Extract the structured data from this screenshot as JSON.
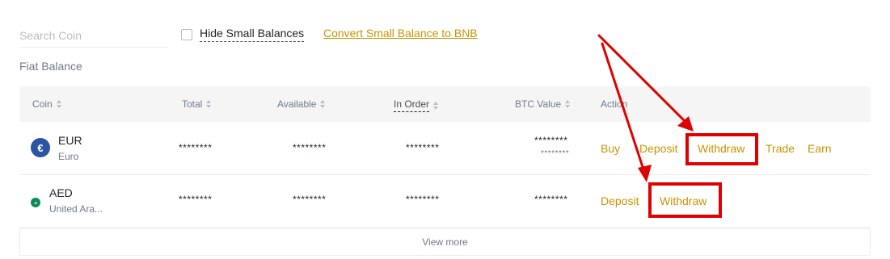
{
  "search": {
    "placeholder": "Search Coin"
  },
  "filters": {
    "hide_small_label": "Hide Small Balances",
    "convert_link": "Convert Small Balance to BNB"
  },
  "section_title": "Fiat Balance",
  "table": {
    "headers": {
      "coin": "Coin",
      "total": "Total",
      "available": "Available",
      "in_order": "In Order",
      "btc_value": "BTC Value",
      "action": "Action"
    },
    "rows": [
      {
        "icon": "euro-icon",
        "icon_glyph": "€",
        "code": "EUR",
        "name": "Euro",
        "total": "********",
        "available": "********",
        "in_order": "********",
        "btc_value": "********",
        "btc_value_sub": "********",
        "actions": [
          "Buy",
          "Deposit",
          "Withdraw",
          "Trade",
          "Earn"
        ]
      },
      {
        "icon": "aed-flag-icon",
        "icon_glyph": "د",
        "code": "AED",
        "name": "United Ara...",
        "total": "********",
        "available": "********",
        "in_order": "********",
        "btc_value": "********",
        "actions": [
          "Deposit",
          "Withdraw"
        ]
      }
    ],
    "view_more": "View more"
  },
  "colors": {
    "accent": "#c99400",
    "annotation_red": "#e00000"
  }
}
